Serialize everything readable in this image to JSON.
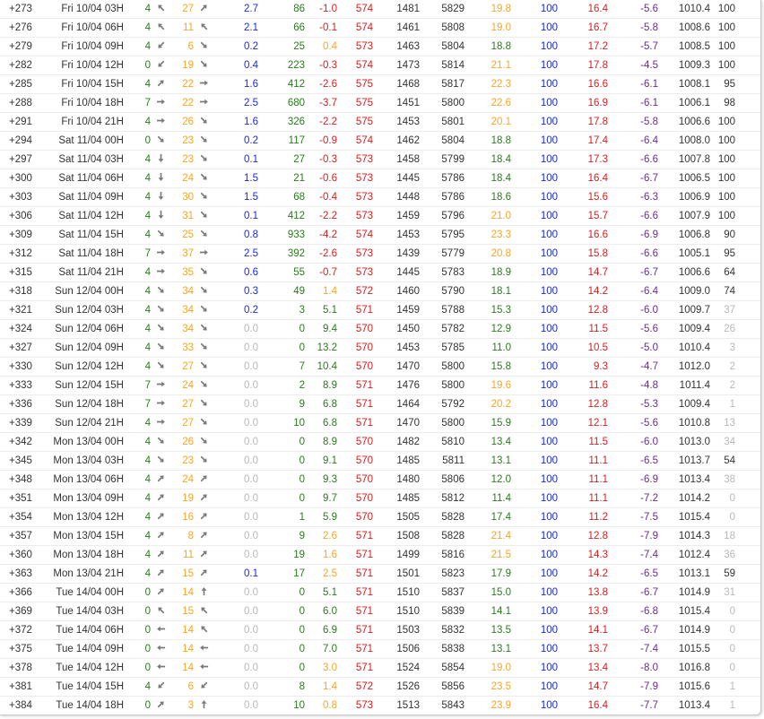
{
  "colors": {
    "text": "#333333",
    "green": "#2a7a1e",
    "orange": "#f3a52b",
    "red": "#d21f1f",
    "blue": "#1a2bd6",
    "purple": "#6a2c8c",
    "gray": "#b9b9b9",
    "arrow": "#7a7a7a"
  },
  "columns": [
    "offset",
    "datetime",
    "wind_speed",
    "wind_dir",
    "gust",
    "gust_dir",
    "precip",
    "cape",
    "li",
    "thickness",
    "gh850",
    "gh500",
    "t850",
    "rh",
    "t2m",
    "td",
    "pressure",
    "cloud",
    "base"
  ],
  "rows": [
    [
      "+273",
      "Fri 10/04 03H",
      "4",
      "NW",
      "27",
      "NE",
      "2.7",
      "86",
      "-1.0",
      "574",
      "1481",
      "5829",
      "19.8",
      "100",
      "16.4",
      "-5.6",
      "1010.4",
      "100",
      "3950"
    ],
    [
      "+276",
      "Fri 10/04 06H",
      "4",
      "NW",
      "11",
      "NW",
      "2.1",
      "66",
      "-0.1",
      "574",
      "1461",
      "5808",
      "19.0",
      "100",
      "16.7",
      "-5.8",
      "1008.6",
      "100",
      "3900"
    ],
    [
      "+279",
      "Fri 10/04 09H",
      "4",
      "SW",
      "6",
      "SE",
      "0.2",
      "25",
      "0.4",
      "573",
      "1463",
      "5804",
      "18.8",
      "100",
      "17.2",
      "-5.7",
      "1008.5",
      "100",
      "3950"
    ],
    [
      "+282",
      "Fri 10/04 12H",
      "0",
      "SW",
      "19",
      "SE",
      "0.4",
      "223",
      "-0.3",
      "574",
      "1473",
      "5814",
      "21.1",
      "100",
      "17.8",
      "-4.5",
      "1009.3",
      "100",
      "4100"
    ],
    [
      "+285",
      "Fri 10/04 15H",
      "4",
      "NE",
      "22",
      "E",
      "1.6",
      "412",
      "-2.6",
      "575",
      "1468",
      "5817",
      "22.3",
      "100",
      "16.6",
      "-6.1",
      "1008.1",
      "95",
      "4000"
    ],
    [
      "+288",
      "Fri 10/04 18H",
      "7",
      "E",
      "22",
      "E",
      "2.5",
      "680",
      "-3.7",
      "575",
      "1451",
      "5800",
      "22.6",
      "100",
      "16.9",
      "-6.1",
      "1006.1",
      "98",
      "4000"
    ],
    [
      "+291",
      "Fri 10/04 21H",
      "4",
      "E",
      "26",
      "SE",
      "1.6",
      "326",
      "-2.2",
      "575",
      "1453",
      "5801",
      "20.1",
      "100",
      "17.8",
      "-5.8",
      "1006.6",
      "100",
      "4000"
    ],
    [
      "+294",
      "Sat 11/04 00H",
      "0",
      "SE",
      "23",
      "SE",
      "0.2",
      "117",
      "-0.9",
      "574",
      "1462",
      "5804",
      "18.8",
      "100",
      "17.4",
      "-6.4",
      "1008.0",
      "100",
      "3950"
    ],
    [
      "+297",
      "Sat 11/04 03H",
      "4",
      "S",
      "23",
      "SE",
      "0.1",
      "27",
      "-0.3",
      "573",
      "1458",
      "5799",
      "18.4",
      "100",
      "17.3",
      "-6.6",
      "1007.8",
      "100",
      "3900"
    ],
    [
      "+300",
      "Sat 11/04 06H",
      "4",
      "S",
      "24",
      "SE",
      "1.5",
      "21",
      "-0.6",
      "573",
      "1445",
      "5786",
      "18.4",
      "100",
      "16.4",
      "-6.7",
      "1006.5",
      "100",
      "3800"
    ],
    [
      "+303",
      "Sat 11/04 09H",
      "4",
      "S",
      "30",
      "SE",
      "1.5",
      "68",
      "-0.4",
      "573",
      "1448",
      "5786",
      "18.6",
      "100",
      "15.6",
      "-6.3",
      "1006.9",
      "100",
      "3750"
    ],
    [
      "+306",
      "Sat 11/04 12H",
      "4",
      "S",
      "31",
      "SE",
      "0.1",
      "412",
      "-2.2",
      "573",
      "1459",
      "5796",
      "21.0",
      "100",
      "15.7",
      "-6.6",
      "1007.9",
      "100",
      "3850"
    ],
    [
      "+309",
      "Sat 11/04 15H",
      "4",
      "SE",
      "25",
      "SE",
      "0.8",
      "933",
      "-4.2",
      "574",
      "1453",
      "5795",
      "23.3",
      "100",
      "16.6",
      "-6.9",
      "1006.8",
      "90",
      "3950"
    ],
    [
      "+312",
      "Sat 11/04 18H",
      "7",
      "E",
      "37",
      "E",
      "2.5",
      "392",
      "-2.6",
      "573",
      "1439",
      "5779",
      "20.8",
      "100",
      "15.8",
      "-6.6",
      "1005.1",
      "95",
      "3850"
    ],
    [
      "+315",
      "Sat 11/04 21H",
      "4",
      "E",
      "35",
      "SE",
      "0.6",
      "55",
      "-0.7",
      "573",
      "1445",
      "5783",
      "18.9",
      "100",
      "14.7",
      "-6.7",
      "1006.6",
      "64",
      "3700"
    ],
    [
      "+318",
      "Sun 12/04 00H",
      "4",
      "SE",
      "34",
      "SE",
      "0.3",
      "49",
      "1.4",
      "572",
      "1460",
      "5790",
      "18.1",
      "100",
      "14.2",
      "-6.4",
      "1009.0",
      "74",
      "3650"
    ],
    [
      "+321",
      "Sun 12/04 03H",
      "4",
      "SE",
      "34",
      "SE",
      "0.2",
      "3",
      "5.1",
      "571",
      "1459",
      "5788",
      "15.3",
      "100",
      "12.8",
      "-6.0",
      "1009.7",
      "37",
      "3450"
    ],
    [
      "+324",
      "Sun 12/04 06H",
      "4",
      "SE",
      "34",
      "SE",
      "0.0",
      "0",
      "9.4",
      "570",
      "1450",
      "5782",
      "12.9",
      "100",
      "11.5",
      "-5.6",
      "1009.4",
      "26",
      "3200"
    ],
    [
      "+327",
      "Sun 12/04 09H",
      "4",
      "SE",
      "33",
      "SE",
      "0.0",
      "0",
      "13.2",
      "570",
      "1453",
      "5785",
      "11.0",
      "100",
      "10.5",
      "-5.0",
      "1010.4",
      "3",
      "3050"
    ],
    [
      "+330",
      "Sun 12/04 12H",
      "4",
      "SE",
      "27",
      "SE",
      "0.0",
      "7",
      "10.4",
      "570",
      "1470",
      "5800",
      "15.8",
      "100",
      "9.3",
      "-4.7",
      "1012.0",
      "2",
      "3150"
    ],
    [
      "+333",
      "Sun 12/04 15H",
      "7",
      "E",
      "24",
      "SE",
      "0.0",
      "2",
      "8.9",
      "571",
      "1476",
      "5800",
      "19.6",
      "100",
      "11.6",
      "-4.8",
      "1011.4",
      "2",
      "3550"
    ],
    [
      "+336",
      "Sun 12/04 18H",
      "7",
      "E",
      "27",
      "SE",
      "0.0",
      "9",
      "6.8",
      "571",
      "1464",
      "5792",
      "20.2",
      "100",
      "12.8",
      "-5.3",
      "1009.4",
      "1",
      "3650"
    ],
    [
      "+339",
      "Sun 12/04 21H",
      "4",
      "E",
      "27",
      "SE",
      "0.0",
      "10",
      "6.8",
      "571",
      "1470",
      "5800",
      "15.9",
      "100",
      "12.1",
      "-5.6",
      "1010.8",
      "13",
      "3450"
    ],
    [
      "+342",
      "Mon 13/04 00H",
      "4",
      "SE",
      "26",
      "SE",
      "0.0",
      "0",
      "8.9",
      "570",
      "1482",
      "5810",
      "13.4",
      "100",
      "11.5",
      "-6.0",
      "1013.0",
      "34",
      "3300"
    ],
    [
      "+345",
      "Mon 13/04 03H",
      "4",
      "SE",
      "23",
      "SE",
      "0.0",
      "0",
      "9.1",
      "570",
      "1485",
      "5811",
      "13.1",
      "100",
      "11.1",
      "-6.5",
      "1013.7",
      "54",
      "3250"
    ],
    [
      "+348",
      "Mon 13/04 06H",
      "4",
      "NE",
      "24",
      "NE",
      "0.0",
      "0",
      "9.3",
      "570",
      "1480",
      "5806",
      "12.0",
      "100",
      "11.1",
      "-6.9",
      "1013.4",
      "38",
      "3200"
    ],
    [
      "+351",
      "Mon 13/04 09H",
      "4",
      "NE",
      "19",
      "NE",
      "0.0",
      "0",
      "9.7",
      "570",
      "1485",
      "5812",
      "11.4",
      "100",
      "11.1",
      "-7.2",
      "1014.2",
      "0",
      "3150"
    ],
    [
      "+354",
      "Mon 13/04 12H",
      "4",
      "NE",
      "16",
      "NE",
      "0.0",
      "1",
      "5.9",
      "570",
      "1505",
      "5828",
      "17.4",
      "100",
      "11.2",
      "-7.5",
      "1015.4",
      "0",
      "3400"
    ],
    [
      "+357",
      "Mon 13/04 15H",
      "4",
      "NE",
      "8",
      "NE",
      "0.0",
      "9",
      "2.6",
      "571",
      "1508",
      "5828",
      "21.4",
      "100",
      "12.8",
      "-7.9",
      "1014.3",
      "18",
      "3700"
    ],
    [
      "+360",
      "Mon 13/04 18H",
      "4",
      "NE",
      "11",
      "NE",
      "0.0",
      "19",
      "1.6",
      "571",
      "1499",
      "5816",
      "21.5",
      "100",
      "14.3",
      "-7.4",
      "1012.4",
      "36",
      "3850"
    ],
    [
      "+363",
      "Mon 13/04 21H",
      "4",
      "NE",
      "15",
      "NE",
      "0.1",
      "17",
      "2.5",
      "571",
      "1501",
      "5823",
      "17.9",
      "100",
      "14.2",
      "-6.5",
      "1013.1",
      "59",
      "3750"
    ],
    [
      "+366",
      "Tue 14/04 00H",
      "0",
      "NE",
      "14",
      "N",
      "0.0",
      "0",
      "5.1",
      "571",
      "1510",
      "5837",
      "15.0",
      "100",
      "13.8",
      "-6.7",
      "1014.9",
      "31",
      "3600"
    ],
    [
      "+369",
      "Tue 14/04 03H",
      "0",
      "NW",
      "15",
      "NW",
      "0.0",
      "0",
      "6.0",
      "571",
      "1510",
      "5839",
      "14.1",
      "100",
      "13.9",
      "-6.8",
      "1015.4",
      "0",
      "3600"
    ],
    [
      "+372",
      "Tue 14/04 06H",
      "0",
      "W",
      "14",
      "NW",
      "0.0",
      "0",
      "6.9",
      "571",
      "1503",
      "5832",
      "13.5",
      "100",
      "14.1",
      "-6.7",
      "1014.9",
      "0",
      "3550"
    ],
    [
      "+375",
      "Tue 14/04 09H",
      "0",
      "W",
      "14",
      "W",
      "0.0",
      "0",
      "7.0",
      "571",
      "1506",
      "5838",
      "13.1",
      "100",
      "13.7",
      "-7.4",
      "1015.5",
      "0",
      "3500"
    ],
    [
      "+378",
      "Tue 14/04 12H",
      "0",
      "W",
      "14",
      "W",
      "0.0",
      "0",
      "3.0",
      "571",
      "1524",
      "5854",
      "19.0",
      "100",
      "13.4",
      "-8.0",
      "1016.8",
      "0",
      "3650"
    ],
    [
      "+381",
      "Tue 14/04 15H",
      "4",
      "SW",
      "6",
      "SW",
      "0.0",
      "8",
      "1.4",
      "572",
      "1526",
      "5856",
      "23.5",
      "100",
      "14.7",
      "-7.9",
      "1015.6",
      "1",
      "3950"
    ],
    [
      "+384",
      "Tue 14/04 18H",
      "0",
      "NE",
      "3",
      "N",
      "0.0",
      "10",
      "0.8",
      "573",
      "1513",
      "5843",
      "23.9",
      "100",
      "16.4",
      "-7.7",
      "1013.4",
      "1",
      "4100"
    ]
  ]
}
